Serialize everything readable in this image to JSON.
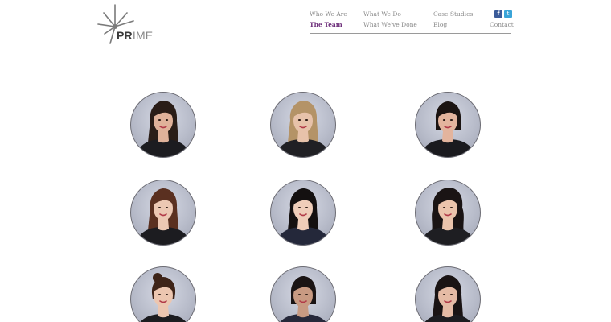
{
  "brand": {
    "logo_text_bold": "PR",
    "logo_text_light": "IME"
  },
  "nav": {
    "items": [
      {
        "label": "Who We Are",
        "active": false
      },
      {
        "label": "The Team",
        "active": true
      },
      {
        "label": "What We Do",
        "active": false
      },
      {
        "label": "What We've Done",
        "active": false
      },
      {
        "label": "Case Studies",
        "active": false
      },
      {
        "label": "Blog",
        "active": false
      },
      {
        "label": "Contact",
        "active": false
      }
    ],
    "social": [
      {
        "icon": "facebook-icon",
        "glyph": "f"
      },
      {
        "icon": "twitter-icon",
        "glyph": "t"
      }
    ]
  },
  "colors": {
    "active_nav": "#6d2e7a",
    "nav_text": "#8a8a8a",
    "facebook": "#3b5b99",
    "twitter": "#3aa4d8"
  },
  "team": {
    "portraits": [
      {
        "icon": "portrait-photo",
        "hair": "#2a1d17",
        "skin": "#e0b29a",
        "top": "#1c1c20",
        "style": "long"
      },
      {
        "icon": "portrait-photo",
        "hair": "#b49367",
        "skin": "#e7c2aa",
        "top": "#202024",
        "style": "long"
      },
      {
        "icon": "portrait-photo",
        "hair": "#1b1412",
        "skin": "#e3b49d",
        "top": "#1a1a1e",
        "style": "bob"
      },
      {
        "icon": "portrait-photo",
        "hair": "#5a3020",
        "skin": "#ecc8b3",
        "top": "#1c1c20",
        "style": "long"
      },
      {
        "icon": "portrait-photo",
        "hair": "#141010",
        "skin": "#efcdb9",
        "top": "#24283a",
        "style": "long"
      },
      {
        "icon": "portrait-photo",
        "hair": "#1a1414",
        "skin": "#ebc4ac",
        "top": "#1e1e22",
        "style": "wavy"
      },
      {
        "icon": "portrait-photo",
        "hair": "#3e2418",
        "skin": "#ecc6b0",
        "top": "#1c1c20",
        "style": "bun"
      },
      {
        "icon": "portrait-photo",
        "hair": "#1a1414",
        "skin": "#c89a82",
        "top": "#26283a",
        "style": "bob"
      },
      {
        "icon": "portrait-photo",
        "hair": "#1a1414",
        "skin": "#e5bba5",
        "top": "#1c1c20",
        "style": "long"
      }
    ]
  }
}
